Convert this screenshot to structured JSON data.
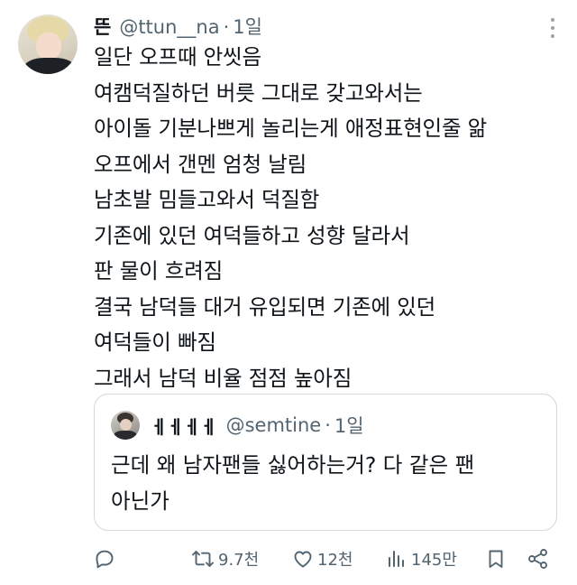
{
  "tweet": {
    "display_name": "뜬",
    "handle": "@ttun__na",
    "separator": "·",
    "time": "1일",
    "lines": [
      "일단 오프때 안씻음",
      "여캠덕질하던 버릇 그대로 갖고와서는",
      "아이돌 기분나쁘게 놀리는게 애정표현인줄 앎",
      "오프에서 갠멘 엄청 날림",
      "남초발 밈들고와서 덕질함",
      "기존에 있던 여덕들하고 성향 달라서",
      "판 물이 흐려짐",
      "결국 남덕들 대거 유입되면 기존에 있던",
      "여덕들이 빠짐",
      "그래서 남덕 비율 점점 높아짐"
    ]
  },
  "quoted": {
    "display_name": "ㅔㅔㅔㅔ",
    "handle": "@semtine",
    "separator": "·",
    "time": "1일",
    "lines": [
      "근데 왜 남자팬들 싫어하는거? 다 같은 팬",
      "아닌가"
    ]
  },
  "actions": {
    "reply": {
      "icon": "reply-icon",
      "count": ""
    },
    "retweet": {
      "icon": "retweet-icon",
      "count": "9.7천"
    },
    "like": {
      "icon": "heart-icon",
      "count": "12천"
    },
    "views": {
      "icon": "views-icon",
      "count": "145만"
    },
    "bookmark": {
      "icon": "bookmark-icon"
    },
    "share": {
      "icon": "share-icon"
    }
  },
  "colors": {
    "text": "#0f1419",
    "secondary": "#536471",
    "border": "#cfd9de"
  }
}
